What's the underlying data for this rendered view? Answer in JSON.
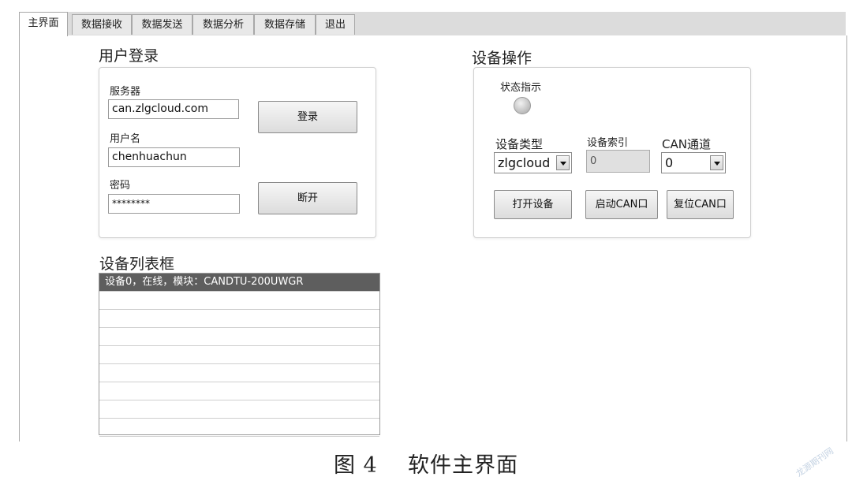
{
  "tabs": [
    {
      "label": "主界面",
      "active": true
    },
    {
      "label": "数据接收",
      "active": false
    },
    {
      "label": "数据发送",
      "active": false
    },
    {
      "label": "数据分析",
      "active": false
    },
    {
      "label": "数据存储",
      "active": false
    },
    {
      "label": "退出",
      "active": false
    }
  ],
  "login": {
    "title": "用户登录",
    "server_label": "服务器",
    "server_value": "can.zlgcloud.com",
    "username_label": "用户名",
    "username_value": "chenhuachun",
    "password_label": "密码",
    "password_value": "********",
    "login_button": "登录",
    "disconnect_button": "断开"
  },
  "device": {
    "title": "设备操作",
    "status_label": "状态指示",
    "type_label": "设备类型",
    "type_value": "zlgcloud",
    "index_label": "设备索引",
    "index_value": "0",
    "channel_label": "CAN通道",
    "channel_value": "0",
    "open_button": "打开设备",
    "start_button": "启动CAN口",
    "reset_button": "复位CAN口"
  },
  "device_list": {
    "title": "设备列表框",
    "items": [
      "设备0，在线，模块：CANDTU-200UWGR"
    ]
  },
  "caption": "图 4    软件主界面",
  "watermark": "龙源期刊网"
}
